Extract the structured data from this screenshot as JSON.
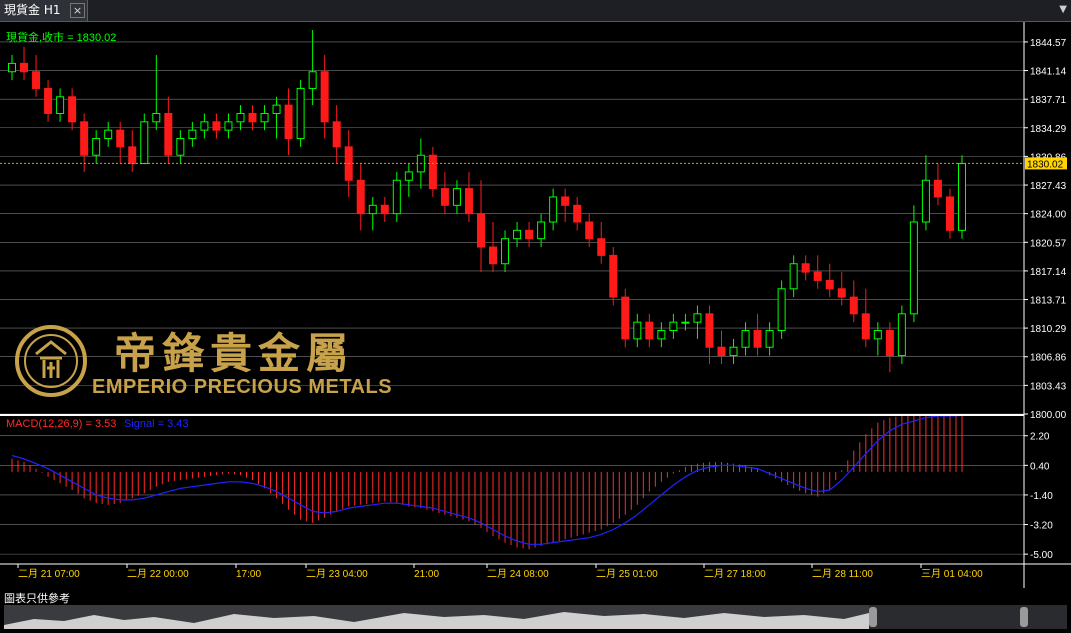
{
  "tab": {
    "title": "現貨金 H1",
    "close": "×",
    "menu": "▼"
  },
  "price_pane": {
    "label": "現貨金,收市 = 1830.02",
    "current_price": "1830.02",
    "y_ticks": [
      "1844.57",
      "1841.14",
      "1837.71",
      "1834.29",
      "1830.86",
      "1827.43",
      "1824.00",
      "1820.57",
      "1817.14",
      "1813.71",
      "1810.29",
      "1806.86",
      "1803.43",
      "1800.00"
    ]
  },
  "indicator_pane": {
    "macd_label": "MACD(12,26,9) = 3.53",
    "signal_label": "Signal = 3.43",
    "y_ticks": [
      "2.20",
      "0.40",
      "-1.40",
      "-3.20",
      "-5.00"
    ]
  },
  "x_axis": {
    "labels": [
      "二月 21 07:00",
      "二月 22 00:00",
      "17:00",
      "二月 23 04:00",
      "21:00",
      "二月 24 08:00",
      "二月 25 01:00",
      "二月 27 18:00",
      "二月 28 11:00",
      "三月 01 04:00"
    ]
  },
  "watermark": {
    "cn": "帝鋒貴金屬",
    "en": "EMPERIO PRECIOUS METALS"
  },
  "footer": {
    "disclaimer": "圖表只供參考"
  },
  "colors": {
    "up": "#00ff00",
    "down": "#ff1a1a",
    "signal": "#1f24ff",
    "histogram": "#ff2a2a",
    "axis_text": "#ffffff",
    "xaxis_text": "#ffd400",
    "current_price_box": "#ffd400"
  },
  "chart_data": [
    {
      "type": "candlestick",
      "title": "現貨金 H1",
      "ylim": [
        1800.0,
        1846.0
      ],
      "candles": [
        [
          1841,
          1843,
          1840,
          1842
        ],
        [
          1842,
          1844,
          1840,
          1841
        ],
        [
          1841,
          1843,
          1838,
          1839
        ],
        [
          1839,
          1840,
          1835,
          1836
        ],
        [
          1836,
          1839,
          1835,
          1838
        ],
        [
          1838,
          1839,
          1834,
          1835
        ],
        [
          1835,
          1836,
          1829,
          1831
        ],
        [
          1831,
          1834,
          1830,
          1833
        ],
        [
          1833,
          1835,
          1832,
          1834
        ],
        [
          1834,
          1835,
          1830,
          1832
        ],
        [
          1832,
          1834,
          1829,
          1830
        ],
        [
          1830,
          1836,
          1830,
          1835
        ],
        [
          1835,
          1843,
          1834,
          1836
        ],
        [
          1836,
          1838,
          1830,
          1831
        ],
        [
          1831,
          1834,
          1830,
          1833
        ],
        [
          1833,
          1835,
          1832,
          1834
        ],
        [
          1834,
          1836,
          1833,
          1835
        ],
        [
          1835,
          1836,
          1833,
          1834
        ],
        [
          1834,
          1836,
          1833,
          1835
        ],
        [
          1835,
          1837,
          1834,
          1836
        ],
        [
          1836,
          1837,
          1834,
          1835
        ],
        [
          1835,
          1837,
          1834,
          1836
        ],
        [
          1836,
          1838,
          1833,
          1837
        ],
        [
          1837,
          1839,
          1831,
          1833
        ],
        [
          1833,
          1840,
          1832,
          1839
        ],
        [
          1839,
          1846,
          1837,
          1841
        ],
        [
          1841,
          1843,
          1833,
          1835
        ],
        [
          1835,
          1837,
          1830,
          1832
        ],
        [
          1832,
          1834,
          1826,
          1828
        ],
        [
          1828,
          1830,
          1822,
          1824
        ],
        [
          1824,
          1826,
          1822,
          1825
        ],
        [
          1825,
          1826,
          1823,
          1824
        ],
        [
          1824,
          1829,
          1823,
          1828
        ],
        [
          1828,
          1830,
          1826,
          1829
        ],
        [
          1829,
          1833,
          1827,
          1831
        ],
        [
          1831,
          1832,
          1826,
          1827
        ],
        [
          1827,
          1829,
          1824,
          1825
        ],
        [
          1825,
          1828,
          1824,
          1827
        ],
        [
          1827,
          1829,
          1823,
          1824
        ],
        [
          1824,
          1828,
          1817,
          1820
        ],
        [
          1820,
          1823,
          1817,
          1818
        ],
        [
          1818,
          1822,
          1817,
          1821
        ],
        [
          1821,
          1823,
          1820,
          1822
        ],
        [
          1822,
          1823,
          1820,
          1821
        ],
        [
          1821,
          1824,
          1820,
          1823
        ],
        [
          1823,
          1827,
          1822,
          1826
        ],
        [
          1826,
          1827,
          1823,
          1825
        ],
        [
          1825,
          1826,
          1822,
          1823
        ],
        [
          1823,
          1824,
          1820,
          1821
        ],
        [
          1821,
          1823,
          1818,
          1819
        ],
        [
          1819,
          1820,
          1813,
          1814
        ],
        [
          1814,
          1815,
          1808,
          1809
        ],
        [
          1809,
          1812,
          1808,
          1811
        ],
        [
          1811,
          1812,
          1808,
          1809
        ],
        [
          1809,
          1811,
          1808,
          1810
        ],
        [
          1810,
          1812,
          1809,
          1811
        ],
        [
          1811,
          1812,
          1810,
          1811
        ],
        [
          1811,
          1813,
          1809,
          1812
        ],
        [
          1812,
          1813,
          1806,
          1808
        ],
        [
          1808,
          1810,
          1806,
          1807
        ],
        [
          1807,
          1809,
          1806,
          1808
        ],
        [
          1808,
          1811,
          1807,
          1810
        ],
        [
          1810,
          1812,
          1807,
          1808
        ],
        [
          1808,
          1811,
          1807,
          1810
        ],
        [
          1810,
          1816,
          1809,
          1815
        ],
        [
          1815,
          1819,
          1814,
          1818
        ],
        [
          1818,
          1819,
          1816,
          1817
        ],
        [
          1817,
          1819,
          1815,
          1816
        ],
        [
          1816,
          1818,
          1814,
          1815
        ],
        [
          1815,
          1817,
          1813,
          1814
        ],
        [
          1814,
          1816,
          1811,
          1812
        ],
        [
          1812,
          1815,
          1808,
          1809
        ],
        [
          1809,
          1811,
          1807,
          1810
        ],
        [
          1810,
          1811,
          1805,
          1807
        ],
        [
          1807,
          1813,
          1806,
          1812
        ],
        [
          1812,
          1825,
          1811,
          1823
        ],
        [
          1823,
          1831,
          1822,
          1828
        ],
        [
          1828,
          1830,
          1825,
          1826
        ],
        [
          1826,
          1827,
          1821,
          1822
        ],
        [
          1822,
          1831,
          1821,
          1830
        ]
      ]
    },
    {
      "type": "bar",
      "title": "MACD(12,26,9)",
      "ylim": [
        -5.6,
        3.4
      ],
      "series": [
        {
          "name": "MACD(12,26,9)",
          "kind": "histogram",
          "values": [
            0.8,
            0.6,
            0.2,
            -0.3,
            -0.7,
            -1.1,
            -1.6,
            -1.9,
            -2.0,
            -1.9,
            -1.6,
            -1.3,
            -0.9,
            -0.6,
            -0.5,
            -0.4,
            -0.3,
            -0.2,
            -0.1,
            -0.2,
            -0.5,
            -1.0,
            -1.6,
            -2.3,
            -2.9,
            -3.1,
            -2.8,
            -2.4,
            -2.1,
            -2.0,
            -1.9,
            -1.8,
            -1.9,
            -2.1,
            -2.2,
            -2.4,
            -2.6,
            -2.8,
            -3.0,
            -3.4,
            -3.9,
            -4.3,
            -4.6,
            -4.7,
            -4.5,
            -4.3,
            -4.1,
            -3.9,
            -3.7,
            -3.5,
            -3.1,
            -2.6,
            -2.0,
            -1.2,
            -0.6,
            -0.1,
            0.3,
            0.5,
            0.6,
            0.6,
            0.5,
            0.4,
            0.2,
            -0.2,
            -0.6,
            -1.0,
            -1.3,
            -1.5,
            -1.1,
            0.1,
            1.3,
            2.3,
            3.0,
            3.3,
            3.4,
            3.5,
            3.5,
            3.5,
            3.5,
            3.5
          ]
        },
        {
          "name": "Signal",
          "kind": "line",
          "values": [
            1.0,
            0.8,
            0.5,
            0.2,
            -0.2,
            -0.6,
            -1.0,
            -1.4,
            -1.6,
            -1.7,
            -1.7,
            -1.6,
            -1.4,
            -1.2,
            -1.0,
            -0.9,
            -0.8,
            -0.7,
            -0.6,
            -0.6,
            -0.7,
            -0.9,
            -1.2,
            -1.6,
            -2.0,
            -2.4,
            -2.5,
            -2.4,
            -2.2,
            -2.1,
            -2.0,
            -1.9,
            -1.9,
            -2.0,
            -2.1,
            -2.2,
            -2.4,
            -2.6,
            -2.8,
            -3.1,
            -3.5,
            -3.9,
            -4.2,
            -4.4,
            -4.4,
            -4.3,
            -4.2,
            -4.1,
            -4.0,
            -3.8,
            -3.5,
            -3.1,
            -2.6,
            -2.0,
            -1.4,
            -0.8,
            -0.3,
            0.1,
            0.3,
            0.4,
            0.4,
            0.3,
            0.2,
            -0.1,
            -0.4,
            -0.7,
            -1.0,
            -1.2,
            -1.1,
            -0.5,
            0.3,
            1.1,
            1.9,
            2.5,
            2.9,
            3.1,
            3.3,
            3.4,
            3.4,
            3.43
          ]
        }
      ]
    }
  ]
}
